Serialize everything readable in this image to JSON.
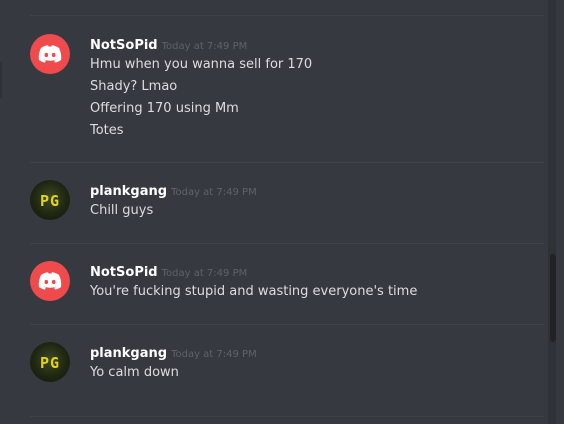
{
  "messages": [
    {
      "username": "NotSoPid",
      "timestamp": "Today at 7:49 PM",
      "avatar": "discord-logo-icon",
      "lines": [
        "Hmu when you wanna sell for 170",
        "Shady? Lmao",
        "Offering 170 using Mm",
        "Totes"
      ]
    },
    {
      "username": "plankgang",
      "timestamp": "Today at 7:49 PM",
      "avatar": "pg-avatar-icon",
      "avatar_text": "PG",
      "lines": [
        "Chill guys"
      ]
    },
    {
      "username": "NotSoPid",
      "timestamp": "Today at 7:49 PM",
      "avatar": "discord-logo-icon",
      "lines": [
        "You're fucking stupid and wasting everyone's time"
      ]
    },
    {
      "username": "plankgang",
      "timestamp": "Today at 7:49 PM",
      "avatar": "pg-avatar-icon",
      "avatar_text": "PG",
      "lines": [
        "Yo calm down"
      ]
    }
  ],
  "colors": {
    "background": "#36393f",
    "username": "#ffffff",
    "message_text": "#dcddde",
    "timestamp": "#5f6369",
    "discord_avatar": "#ef4b4d",
    "pg_text": "#e3d21a"
  }
}
